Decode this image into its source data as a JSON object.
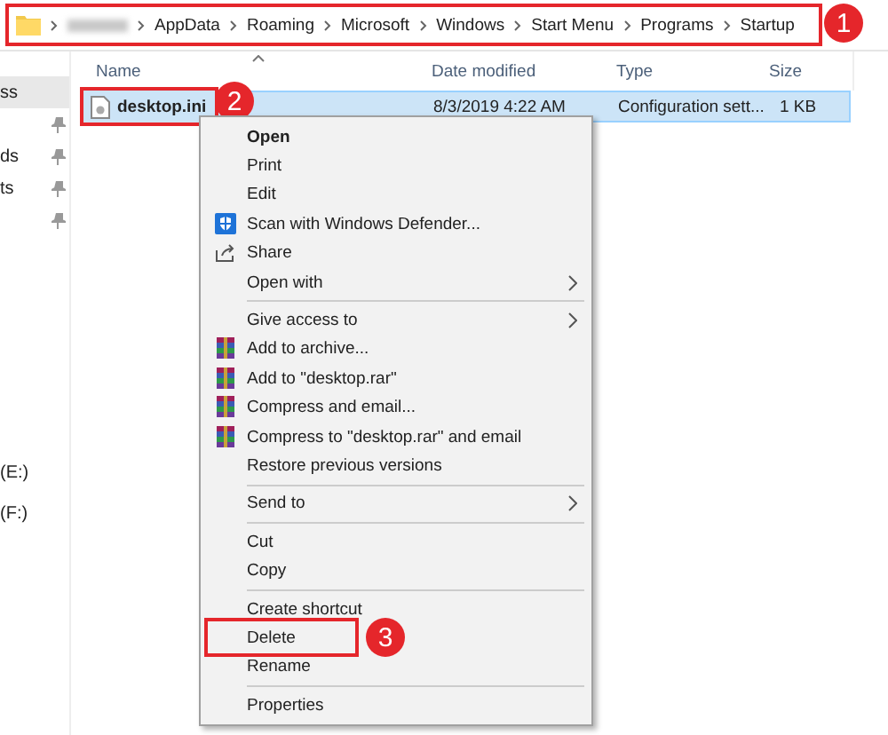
{
  "breadcrumb": {
    "callout": "1",
    "segments": [
      {
        "kind": "blurred"
      },
      {
        "kind": "text",
        "label": "AppData"
      },
      {
        "kind": "text",
        "label": "Roaming"
      },
      {
        "kind": "text",
        "label": "Microsoft"
      },
      {
        "kind": "text",
        "label": "Windows"
      },
      {
        "kind": "text",
        "label": "Start Menu"
      },
      {
        "kind": "text",
        "label": "Programs"
      },
      {
        "kind": "text",
        "label": "Startup"
      }
    ]
  },
  "sidebar": {
    "items": [
      {
        "label": "ss",
        "pinned": false,
        "selected": true
      },
      {
        "pinned": true,
        "selected": false
      },
      {
        "label": "ds",
        "pinned": true,
        "selected": false
      },
      {
        "label": "ts",
        "pinned": true,
        "selected": false
      },
      {
        "pinned": true,
        "selected": false
      }
    ],
    "drives": [
      "(E:)",
      "(F:)"
    ]
  },
  "table": {
    "columns": [
      "Name",
      "Date modified",
      "Type",
      "Size"
    ],
    "rows": [
      {
        "name": "desktop.ini",
        "date": "8/3/2019 4:22 AM",
        "type": "Configuration sett...",
        "size": "1 KB",
        "selected": true,
        "callout": "2"
      }
    ]
  },
  "context_menu": {
    "groups": [
      {
        "items": [
          {
            "label": "Open",
            "kind": "plain",
            "submenu": false,
            "default": true
          },
          {
            "label": "Print",
            "kind": "plain",
            "submenu": false,
            "default": false
          },
          {
            "label": "Edit",
            "kind": "plain",
            "submenu": false,
            "default": false
          },
          {
            "label": "Scan with Windows Defender...",
            "kind": "shield",
            "submenu": false,
            "default": false
          },
          {
            "label": "Share",
            "kind": "share",
            "submenu": false,
            "default": false
          },
          {
            "label": "Open with",
            "kind": "plain",
            "submenu": true,
            "default": false
          }
        ]
      },
      {
        "items": [
          {
            "label": "Give access to",
            "kind": "plain",
            "submenu": true,
            "default": false
          },
          {
            "label": "Add to archive...",
            "kind": "archive",
            "submenu": false,
            "default": false
          },
          {
            "label": "Add to \"desktop.rar\"",
            "kind": "archive",
            "submenu": false,
            "default": false
          },
          {
            "label": "Compress and email...",
            "kind": "archive",
            "submenu": false,
            "default": false
          },
          {
            "label": "Compress to \"desktop.rar\" and email",
            "kind": "archive",
            "submenu": false,
            "default": false
          },
          {
            "label": "Restore previous versions",
            "kind": "plain",
            "submenu": false,
            "default": false
          }
        ]
      },
      {
        "items": [
          {
            "label": "Send to",
            "kind": "plain",
            "submenu": true,
            "default": false
          }
        ]
      },
      {
        "items": [
          {
            "label": "Cut",
            "kind": "plain",
            "submenu": false,
            "default": false
          },
          {
            "label": "Copy",
            "kind": "plain",
            "submenu": false,
            "default": false
          }
        ]
      },
      {
        "items": [
          {
            "label": "Create shortcut",
            "kind": "plain",
            "submenu": false,
            "default": false
          },
          {
            "label": "Delete",
            "kind": "plain",
            "submenu": false,
            "default": false,
            "callout": "3"
          },
          {
            "label": "Rename",
            "kind": "plain",
            "submenu": false,
            "default": false
          }
        ]
      },
      {
        "items": [
          {
            "label": "Properties",
            "kind": "plain",
            "submenu": false,
            "default": false
          }
        ]
      }
    ]
  }
}
